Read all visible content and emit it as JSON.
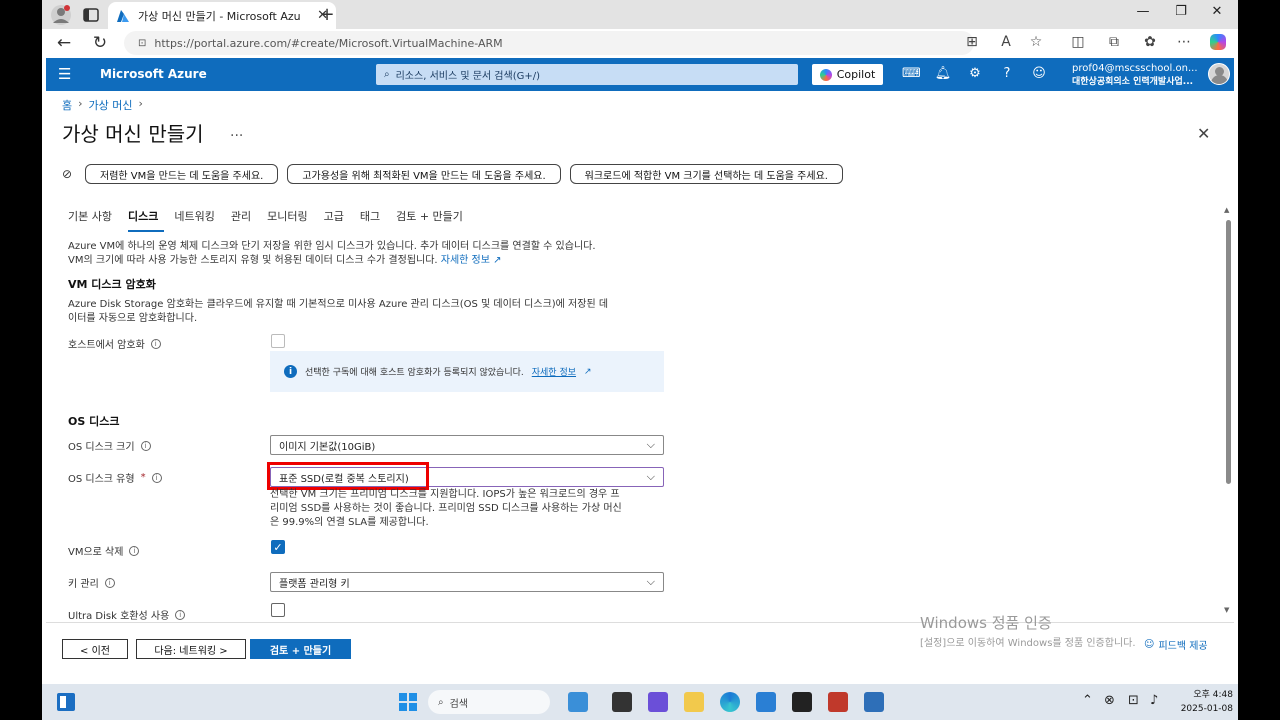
{
  "browser": {
    "tab_title": "가상 머신 만들기 - Microsoft Azu",
    "url": "https://portal.azure.com/#create/Microsoft.VirtualMachine-ARM"
  },
  "azure": {
    "brand": "Microsoft Azure",
    "search_placeholder": "리소스, 서비스 및 문서 검색(G+/)",
    "copilot_label": "Copilot",
    "account_email": "prof04@mscsschool.on...",
    "account_org": "대한상공회의소 인력개발사업..."
  },
  "breadcrumb": {
    "home": "홈",
    "vm": "가상 머신"
  },
  "page": {
    "title": "가상 머신 만들기",
    "more": "..."
  },
  "copilot_prompts": [
    "저렴한 VM을 만드는 데 도움을 주세요.",
    "고가용성을 위해 최적화된 VM을 만드는 데 도움을 주세요.",
    "워크로드에 적합한 VM 크기를 선택하는 데 도움을 주세요."
  ],
  "tabs": [
    "기본 사항",
    "디스크",
    "네트워킹",
    "관리",
    "모니터링",
    "고급",
    "태그",
    "검토 + 만들기"
  ],
  "intro": {
    "line1": "Azure VM에 하나의 운영 체제 디스크와 단기 저장을 위한 임시 디스크가 있습니다. 추가 데이터 디스크를 연결할 수 있습니다.",
    "line2": "VM의 크기에 따라 사용 가능한 스토리지 유형 및 허용된 데이터 디스크 수가 결정됩니다.",
    "learn_more": "자세한 정보"
  },
  "encryption": {
    "heading": "VM 디스크 암호화",
    "line1": "Azure Disk Storage 암호화는 클라우드에 유지할 때 기본적으로 미사용 Azure 관리 디스크(OS 및 데이터 디스크)에 저장된 데",
    "line2": "이터를 자동으로 암호화합니다.",
    "host_label": "호스트에서 암호화",
    "host_checked": false,
    "info_text": "선택한 구독에 대해 호스트 암호화가 등록되지 않았습니다.",
    "info_link": "자세한 정보"
  },
  "os_disk": {
    "heading": "OS 디스크",
    "size_label": "OS 디스크 크기",
    "size_value": "이미지 기본값(10GiB)",
    "type_label": "OS 디스크 유형",
    "type_required": "*",
    "type_value": "표준 SSD(로컬 중복 스토리지)",
    "type_note1": "선택한 VM 크기는 프리미엄 디스크를 지원합니다. IOPS가 높은 워크로드의 경우 프",
    "type_note2": "리미엄 SSD를 사용하는 것이 좋습니다. 프리미엄 SSD 디스크를 사용하는 가상 머신",
    "type_note3": "은 99.9%의 연결 SLA를 제공합니다.",
    "delete_label": "VM으로 삭제",
    "delete_checked": true,
    "key_label": "키 관리",
    "key_value": "플랫폼 관리형 키",
    "ultra_label": "Ultra Disk 호환성 사용",
    "ultra_checked": false
  },
  "footer": {
    "prev": "< 이전",
    "next": "다음: 네트워킹 >",
    "review": "검토 + 만들기",
    "feedback": "피드백 제공"
  },
  "watermark": {
    "line1": "Windows 정품 인증",
    "line2": "[설정]으로 이동하여 Windows를 정품 인증합니다."
  },
  "taskbar": {
    "search": "검색",
    "time": "오후 4:48",
    "date": "2025-01-08"
  },
  "colors": {
    "azure_blue": "#0f6cbd",
    "highlight_red": "#ee0000"
  }
}
